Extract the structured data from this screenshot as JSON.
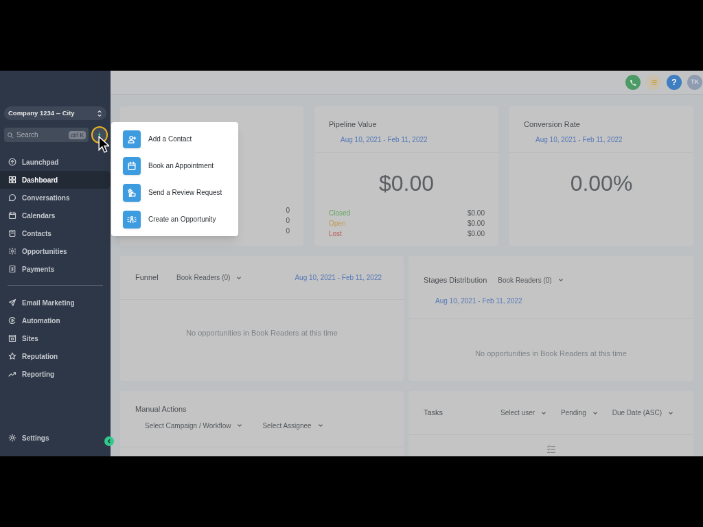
{
  "sidebar": {
    "company": "Company 1234 -- City",
    "search": {
      "placeholder": "Search",
      "shortcut": "ctrl K"
    },
    "nav": [
      {
        "label": "Launchpad",
        "selected": false
      },
      {
        "label": "Dashboard",
        "selected": true
      },
      {
        "label": "Conversations",
        "selected": false
      },
      {
        "label": "Calendars",
        "selected": false
      },
      {
        "label": "Contacts",
        "selected": false
      },
      {
        "label": "Opportunities",
        "selected": false
      },
      {
        "label": "Payments",
        "selected": false
      }
    ],
    "nav_secondary": [
      {
        "label": "Email Marketing",
        "selected": false
      },
      {
        "label": "Automation",
        "selected": false
      },
      {
        "label": "Sites",
        "selected": false
      },
      {
        "label": "Reputation",
        "selected": false
      },
      {
        "label": "Reporting",
        "selected": false
      }
    ],
    "settings": "Settings"
  },
  "header": {
    "help": "?",
    "avatar": "TK"
  },
  "quick_menu": [
    {
      "label": "Add a Contact"
    },
    {
      "label": "Book an Appointment"
    },
    {
      "label": "Send a Review Request"
    },
    {
      "label": "Create an Opportunity"
    }
  ],
  "opportunities_card": {
    "values": [
      "0",
      "0",
      "0"
    ]
  },
  "stat_cards": [
    {
      "title": "Pipeline Value",
      "date_range": "Aug 10, 2021 - Feb 11, 2022",
      "value": "$0.00",
      "rows": [
        {
          "label": "Closed",
          "value": "$0.00",
          "color": "#5fa55f"
        },
        {
          "label": "Open",
          "value": "$0.00",
          "color": "#c29a52"
        },
        {
          "label": "Lost",
          "value": "$0.00",
          "color": "#bb5a57"
        }
      ]
    },
    {
      "title": "Conversion Rate",
      "date_range": "Aug 10, 2021 - Feb 11, 2022",
      "value": "0.00%"
    }
  ],
  "funnel": {
    "title": "Funnel",
    "pipeline": "Book Readers (0)",
    "date_range": "Aug 10, 2021 - Feb 11, 2022",
    "empty": "No opportunities in Book Readers at this time"
  },
  "stages": {
    "title": "Stages Distribution",
    "pipeline": "Book Readers (0)",
    "date_range": "Aug 10, 2021 - Feb 11, 2022",
    "empty": "No opportunities in Book Readers at this time"
  },
  "manual_actions": {
    "title": "Manual Actions",
    "filters": [
      "Select Campaign / Workflow",
      "Select Assignee"
    ]
  },
  "tasks": {
    "title": "Tasks",
    "filters": [
      "Select user",
      "Pending",
      "Due Date (ASC)"
    ]
  }
}
